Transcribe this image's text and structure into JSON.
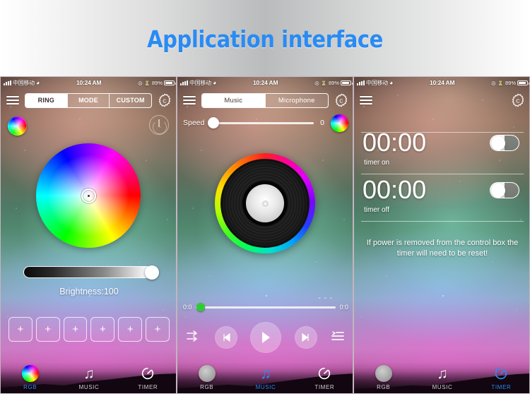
{
  "banner": {
    "title": "Application interface"
  },
  "statusbar": {
    "carrier": "中国移动",
    "wifi_icon": "wifi-icon",
    "time": "10:24 AM",
    "location_icon": "location-icon",
    "alarm_icon": "alarm-icon",
    "battery_percent": "89%",
    "battery_icon": "battery-icon"
  },
  "panels": [
    {
      "id": "rgb-panel",
      "menu_icon": "hamburger-menu-icon",
      "settings_icon": "gear-icon",
      "segments": [
        {
          "label": "RING",
          "active": true
        },
        {
          "label": "MODE",
          "active": false
        },
        {
          "label": "CUSTOM",
          "active": false
        }
      ],
      "color_wheel_button_icon": "color-wheel-icon",
      "power_button_icon": "power-icon",
      "color_wheel": {
        "name": "hsv-color-wheel",
        "picker_position": "center"
      },
      "brightness": {
        "label": "Brightness:100",
        "value": 100,
        "min": 0,
        "max": 100
      },
      "preset_buttons": [
        {
          "label": "+"
        },
        {
          "label": "+"
        },
        {
          "label": "+"
        },
        {
          "label": "+"
        },
        {
          "label": "+"
        },
        {
          "label": "+"
        }
      ],
      "tabs": [
        {
          "label": "RGB",
          "icon": "rgb-wheel-icon",
          "active": true
        },
        {
          "label": "MUSIC",
          "icon": "music-note-icon",
          "active": false
        },
        {
          "label": "TIMER",
          "icon": "timer-icon",
          "active": false
        }
      ]
    },
    {
      "id": "music-panel",
      "menu_icon": "hamburger-menu-icon",
      "settings_icon": "gear-icon",
      "segments": [
        {
          "label": "Music",
          "active": true
        },
        {
          "label": "Microphone",
          "active": false
        }
      ],
      "speed": {
        "label": "Speed",
        "value": "0",
        "min": 0,
        "max": 100
      },
      "color_wheel_button_icon": "color-wheel-icon",
      "vinyl": {
        "name": "vinyl-record-visualizer"
      },
      "progress": {
        "elapsed": "0:0",
        "remaining": "0:0",
        "dots": "- - -",
        "value": 0
      },
      "media_controls": [
        {
          "name": "shuffle-icon",
          "label": "shuffle"
        },
        {
          "name": "previous-button",
          "label": "◀◀"
        },
        {
          "name": "play-button",
          "label": "▶"
        },
        {
          "name": "next-button",
          "label": "▶▶"
        },
        {
          "name": "playlist-icon",
          "label": "playlist"
        }
      ],
      "tabs": [
        {
          "label": "RGB",
          "icon": "rgb-wheel-icon",
          "active": false
        },
        {
          "label": "MUSIC",
          "icon": "music-note-icon",
          "active": true
        },
        {
          "label": "TIMER",
          "icon": "timer-icon",
          "active": false
        }
      ]
    },
    {
      "id": "timer-panel",
      "menu_icon": "hamburger-menu-icon",
      "settings_icon": "gear-icon",
      "timers": [
        {
          "time": "00:00",
          "label": "timer on",
          "toggle_on": false
        },
        {
          "time": "00:00",
          "label": "timer off",
          "toggle_on": false
        }
      ],
      "note": "If power is removed from the control box the timer will need to be reset!",
      "tabs": [
        {
          "label": "RGB",
          "icon": "rgb-wheel-icon",
          "active": false
        },
        {
          "label": "MUSIC",
          "icon": "music-note-icon",
          "active": false
        },
        {
          "label": "TIMER",
          "icon": "timer-icon",
          "active": true
        }
      ]
    }
  ],
  "colors": {
    "accent_blue": "#2a8bf2",
    "progress_knob_green": "#2ecc2e",
    "banner_text": "#2a8bf2"
  }
}
